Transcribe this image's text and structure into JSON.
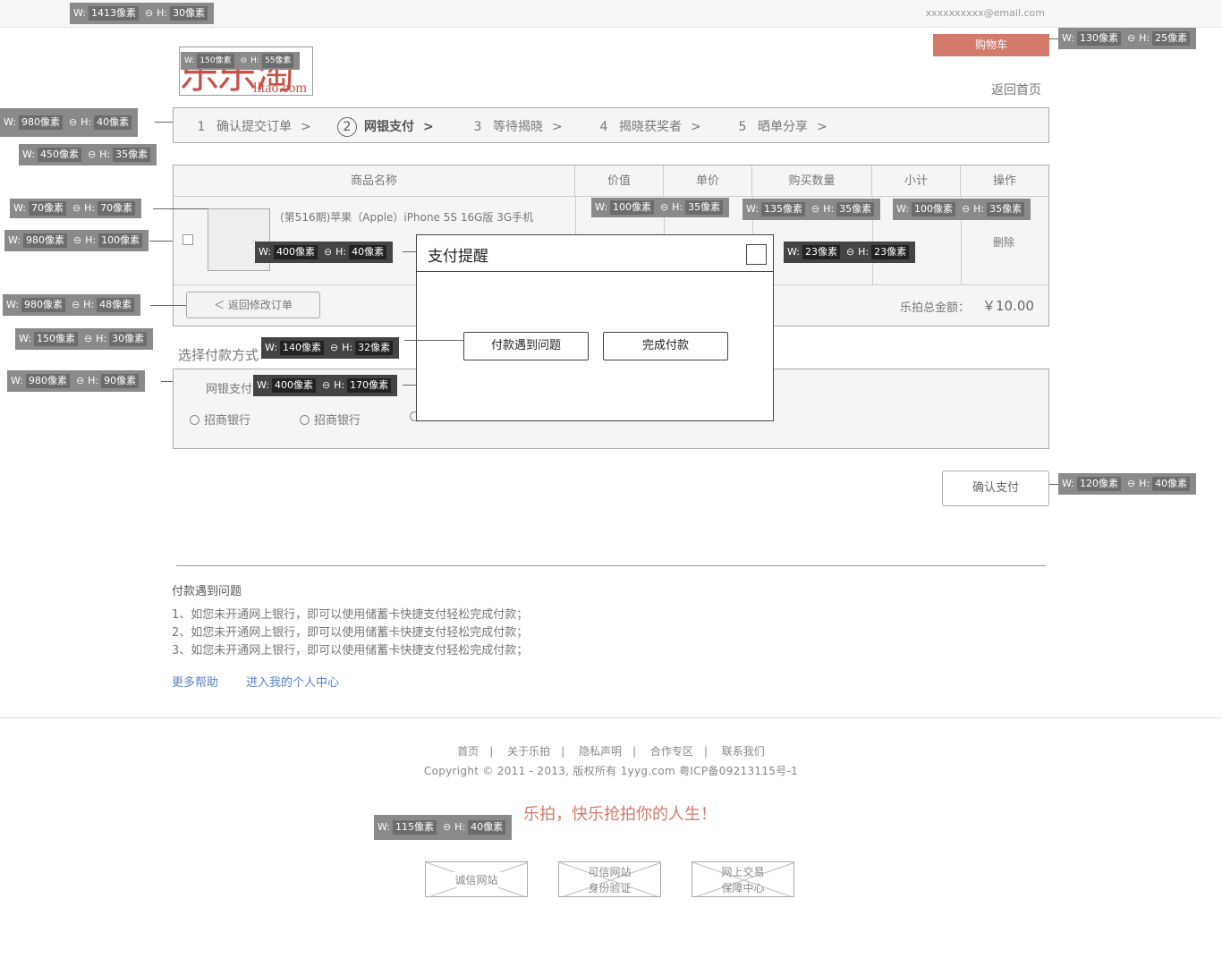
{
  "header": {
    "email": "xxxxxxxxxx@email.com",
    "cart_label": "购物车",
    "back_home": "返回首页",
    "logo_main": "乐乐淘",
    "logo_sub": "lltao.com"
  },
  "steps": [
    {
      "num": "1",
      "label": "确认提交订单",
      "arrow": ">"
    },
    {
      "num": "2",
      "label": "网银支付",
      "arrow": ">"
    },
    {
      "num": "3",
      "label": "等待揭晓",
      "arrow": ">"
    },
    {
      "num": "4",
      "label": "揭晓获奖者",
      "arrow": ">"
    },
    {
      "num": "5",
      "label": "晒单分享",
      "arrow": ">"
    }
  ],
  "table": {
    "headers": [
      "商品名称",
      "价值",
      "单价",
      "购买数量",
      "小计",
      "操作"
    ],
    "row": {
      "name": "(第516期)苹果（Apple）iPhone 5S 16G版 3G手机",
      "action": "删除"
    },
    "back_edit": "＜  返回修改订单",
    "total_label": "乐拍总金额：",
    "total_value": "￥10.00"
  },
  "payment": {
    "title": "选择付款方式",
    "netbank_label": "网银支付",
    "banks": [
      "招商银行",
      "招商银行"
    ],
    "confirm_label": "确认支付"
  },
  "help": {
    "title": "付款遇到问题",
    "lines": [
      "1、如您未开通网上银行，即可以使用储蓄卡快捷支付轻松完成付款；",
      "2、如您未开通网上银行，即可以使用储蓄卡快捷支付轻松完成付款；",
      "3、如您未开通网上银行，即可以使用储蓄卡快捷支付轻松完成付款；"
    ],
    "more_help": "更多帮助",
    "personal_center": "进入我的个人中心"
  },
  "footer": {
    "nav": [
      "首页",
      "关于乐拍",
      "隐私声明",
      "合作专区",
      "联系我们"
    ],
    "separator": "|",
    "copyright": "Copyright © 2011 - 2013, 版权所有 1yyg.com 粤ICP备09213115号-1",
    "slogan": "乐拍，快乐抢拍你的人生！",
    "badges": [
      {
        "line1": "诚信网站",
        "line2": ""
      },
      {
        "line1": "可信网站",
        "line2": "身份验证"
      },
      {
        "line1": "网上交易",
        "line2": "保障中心"
      }
    ]
  },
  "modal": {
    "title": "支付提醒",
    "problem_button": "付款遇到问题",
    "done_button": "完成付款"
  },
  "annotations": {
    "w_label": "W:",
    "h_label": "H:",
    "unit": "像素",
    "tags": [
      {
        "w": "1413",
        "h": "30"
      },
      {
        "w": "130",
        "h": "25"
      },
      {
        "w": "150",
        "h": "55"
      },
      {
        "w": "980",
        "h": "40"
      },
      {
        "w": "450",
        "h": "35"
      },
      {
        "w": "70",
        "h": "70"
      },
      {
        "w": "980",
        "h": "100"
      },
      {
        "w": "100",
        "h": "35"
      },
      {
        "w": "135",
        "h": "35"
      },
      {
        "w": "100",
        "h": "35"
      },
      {
        "w": "400",
        "h": "40"
      },
      {
        "w": "23",
        "h": "23"
      },
      {
        "w": "980",
        "h": "48"
      },
      {
        "w": "150",
        "h": "30"
      },
      {
        "w": "140",
        "h": "32"
      },
      {
        "w": "980",
        "h": "90"
      },
      {
        "w": "400",
        "h": "170"
      },
      {
        "w": "120",
        "h": "40"
      },
      {
        "w": "115",
        "h": "40"
      }
    ]
  }
}
